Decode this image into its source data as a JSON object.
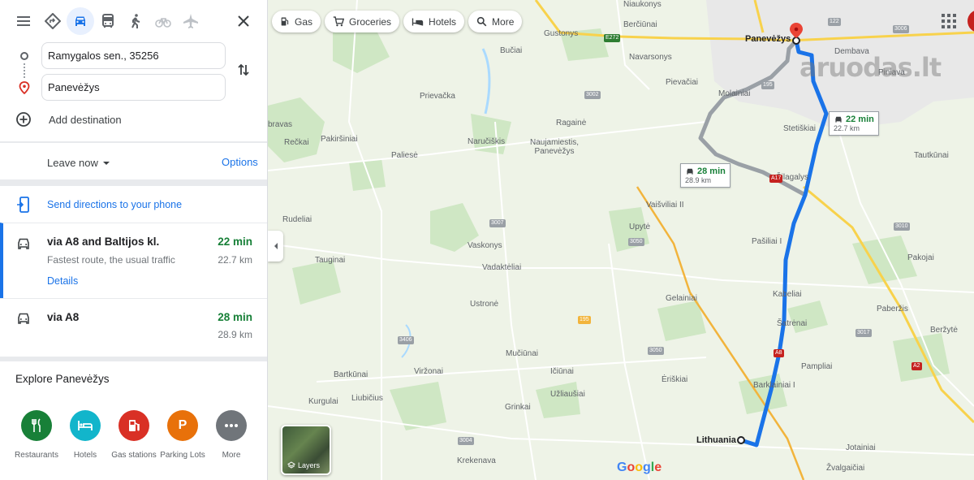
{
  "travel_modes": [
    {
      "name": "best",
      "icon": "diamond-route-icon"
    },
    {
      "name": "driving",
      "icon": "car-icon",
      "active": true
    },
    {
      "name": "transit",
      "icon": "bus-icon"
    },
    {
      "name": "walking",
      "icon": "walking-icon"
    },
    {
      "name": "cycling",
      "icon": "bicycle-icon"
    },
    {
      "name": "flights",
      "icon": "plane-icon"
    }
  ],
  "origin": {
    "value": "Ramygalos sen., 35256"
  },
  "destination": {
    "value": "Panevėžys"
  },
  "add_destination_label": "Add destination",
  "leave_now_label": "Leave now",
  "options_label": "Options",
  "send_directions_label": "Send directions to your phone",
  "routes": [
    {
      "title": "via A8 and Baltijos kl.",
      "subtitle": "Fastest route, the usual traffic",
      "time": "22 min",
      "distance": "22.7 km",
      "details_label": "Details"
    },
    {
      "title": "via A8",
      "time": "28 min",
      "distance": "28.9 km"
    }
  ],
  "explore": {
    "title": "Explore Panevėžys",
    "categories": [
      {
        "label": "Restaurants",
        "color": "#188038",
        "icon": "fork-knife-icon"
      },
      {
        "label": "Hotels",
        "color": "#12b5cb",
        "icon": "bed-icon"
      },
      {
        "label": "Gas stations",
        "color": "#d93025",
        "icon": "fuel-pump-icon"
      },
      {
        "label": "Parking Lots",
        "color": "#e8710a",
        "icon": "parking-icon",
        "glyph": "P"
      },
      {
        "label": "More",
        "color": "#70757a",
        "icon": "more-dots-icon"
      }
    ]
  },
  "map": {
    "chips": [
      {
        "label": "Gas",
        "icon": "fuel-pump-icon"
      },
      {
        "label": "Groceries",
        "icon": "cart-icon"
      },
      {
        "label": "Hotels",
        "icon": "bed-icon"
      },
      {
        "label": "More",
        "icon": "search-icon"
      }
    ],
    "callouts": [
      {
        "time": "22 min",
        "distance": "22.7 km"
      },
      {
        "time": "28 min",
        "distance": "28.9 km"
      }
    ],
    "places": [
      "Panevėžys",
      "Lithuania",
      "Berčiūnai",
      "Gustonys",
      "Bučiai",
      "Niaukonys",
      "Navarsonys",
      "Dembava",
      "Piniava",
      "Pievačiai",
      "Molainiai",
      "Prievačka",
      "bravas",
      "Ragainė",
      "Stetiškiai",
      "Tautkūnai",
      "Rečkai",
      "Pakiršiniai",
      "Paliesė",
      "Naručiškis",
      "Naujamiestis, Panevėžys",
      "Šilagalys",
      "Vaišviliai II",
      "Rudeliai",
      "Upytė",
      "Vaskonys",
      "Pašiliai I",
      "Pakojai",
      "Tauginai",
      "Vadaktėliai",
      "Kabeliai",
      "Gelainiai",
      "Ustronė",
      "Paberžis",
      "Šatrėnai",
      "Beržytė",
      "Mučiūnai",
      "Pampliai",
      "Bartkūnai",
      "Viržonai",
      "Ičiūnai",
      "Ėriškiai",
      "Barklainiai I",
      "Kurgulai",
      "Liubičius",
      "Užliaušiai",
      "Grinkai",
      "Jotainiai",
      "Krekenava",
      "Žvalgaičiai"
    ],
    "road_numbers": [
      "E272",
      "122",
      "3006",
      "195",
      "3002",
      "A17",
      "3007",
      "3010",
      "3050",
      "195",
      "3406",
      "3017",
      "3050",
      "A8",
      "A2",
      "3004"
    ],
    "layers_label": "Layers",
    "google_logo": "Google",
    "watermark": "aruodas.lt"
  }
}
